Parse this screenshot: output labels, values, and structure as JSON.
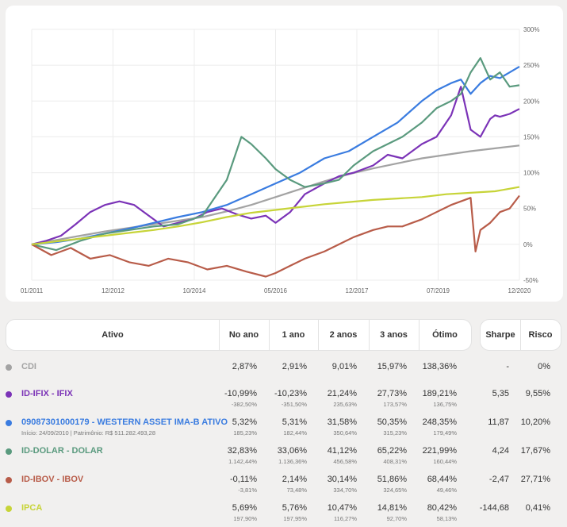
{
  "chart_data": {
    "type": "line",
    "x_labels": [
      "01/2011",
      "12/2012",
      "10/2014",
      "05/2016",
      "12/2017",
      "07/2019",
      "12/2020"
    ],
    "y_ticks": [
      "300%",
      "250%",
      "200%",
      "150%",
      "100%",
      "50%",
      "0%",
      "-50%"
    ],
    "ylim": [
      -50,
      300
    ],
    "grid": true,
    "series": [
      {
        "name": "CDI",
        "color": "#a3a3a3",
        "x": [
          0,
          0.05,
          0.1,
          0.15,
          0.2,
          0.25,
          0.3,
          0.35,
          0.4,
          0.45,
          0.5,
          0.55,
          0.6,
          0.65,
          0.7,
          0.75,
          0.8,
          0.85,
          0.9,
          0.95,
          1.0
        ],
        "y": [
          0,
          6,
          12,
          18,
          23,
          28,
          33,
          38,
          46,
          55,
          66,
          77,
          88,
          98,
          106,
          113,
          120,
          125,
          130,
          134,
          138
        ]
      },
      {
        "name": "ID-IFIX - IFIX",
        "color": "#7b33b7",
        "x": [
          0,
          0.03,
          0.06,
          0.09,
          0.12,
          0.15,
          0.18,
          0.21,
          0.24,
          0.27,
          0.3,
          0.33,
          0.36,
          0.39,
          0.42,
          0.45,
          0.48,
          0.5,
          0.53,
          0.56,
          0.6,
          0.63,
          0.66,
          0.7,
          0.73,
          0.76,
          0.8,
          0.83,
          0.86,
          0.88,
          0.9,
          0.92,
          0.94,
          0.95,
          0.96,
          0.98,
          1.0
        ],
        "y": [
          0,
          5,
          12,
          28,
          45,
          55,
          60,
          55,
          40,
          25,
          30,
          35,
          45,
          50,
          42,
          36,
          40,
          30,
          45,
          70,
          85,
          95,
          100,
          110,
          125,
          120,
          140,
          150,
          180,
          220,
          160,
          150,
          175,
          180,
          178,
          182,
          189
        ]
      },
      {
        "name": "09087301000179 - WESTERN ASSET IMA-B ATIVO",
        "color": "#3a7ce0",
        "x": [
          0,
          0.05,
          0.1,
          0.15,
          0.2,
          0.25,
          0.3,
          0.35,
          0.4,
          0.45,
          0.5,
          0.55,
          0.6,
          0.65,
          0.7,
          0.75,
          0.8,
          0.83,
          0.86,
          0.88,
          0.9,
          0.92,
          0.94,
          0.96,
          0.98,
          1.0
        ],
        "y": [
          0,
          3,
          8,
          15,
          22,
          30,
          38,
          45,
          55,
          70,
          85,
          100,
          120,
          130,
          150,
          170,
          200,
          215,
          225,
          230,
          210,
          225,
          235,
          232,
          240,
          248
        ]
      },
      {
        "name": "ID-DOLAR - DOLAR",
        "color": "#5a9a7e",
        "x": [
          0,
          0.05,
          0.1,
          0.15,
          0.2,
          0.25,
          0.3,
          0.35,
          0.4,
          0.43,
          0.45,
          0.48,
          0.5,
          0.53,
          0.56,
          0.6,
          0.63,
          0.66,
          0.7,
          0.73,
          0.76,
          0.8,
          0.83,
          0.86,
          0.88,
          0.9,
          0.92,
          0.94,
          0.96,
          0.98,
          1.0
        ],
        "y": [
          0,
          -8,
          5,
          15,
          20,
          25,
          28,
          40,
          90,
          150,
          140,
          120,
          105,
          90,
          80,
          85,
          90,
          110,
          130,
          140,
          150,
          170,
          190,
          200,
          210,
          240,
          260,
          230,
          240,
          220,
          222
        ]
      },
      {
        "name": "ID-IBOV - IBOV",
        "color": "#b85c49",
        "x": [
          0,
          0.04,
          0.08,
          0.12,
          0.16,
          0.2,
          0.24,
          0.28,
          0.32,
          0.36,
          0.4,
          0.44,
          0.48,
          0.5,
          0.53,
          0.56,
          0.6,
          0.63,
          0.66,
          0.7,
          0.73,
          0.76,
          0.8,
          0.83,
          0.86,
          0.88,
          0.9,
          0.91,
          0.92,
          0.94,
          0.96,
          0.98,
          1.0
        ],
        "y": [
          0,
          -15,
          -5,
          -20,
          -15,
          -25,
          -30,
          -20,
          -25,
          -35,
          -30,
          -38,
          -45,
          -40,
          -30,
          -20,
          -10,
          0,
          10,
          20,
          25,
          25,
          35,
          45,
          55,
          60,
          65,
          -10,
          20,
          30,
          45,
          50,
          68
        ]
      },
      {
        "name": "IPCA",
        "color": "#c7d438",
        "x": [
          0,
          0.05,
          0.1,
          0.15,
          0.2,
          0.25,
          0.3,
          0.35,
          0.4,
          0.45,
          0.5,
          0.55,
          0.6,
          0.65,
          0.7,
          0.75,
          0.8,
          0.85,
          0.9,
          0.95,
          1.0
        ],
        "y": [
          0,
          4,
          8,
          12,
          16,
          20,
          25,
          31,
          38,
          44,
          48,
          52,
          56,
          59,
          62,
          64,
          66,
          70,
          72,
          74,
          80
        ]
      }
    ]
  },
  "table": {
    "headers": {
      "ativo": "Ativo",
      "no_ano": "No ano",
      "um_ano": "1 ano",
      "dois_anos": "2 anos",
      "tres_anos": "3 anos",
      "otimo": "Ótimo",
      "sharpe": "Sharpe",
      "risco": "Risco"
    },
    "rows": [
      {
        "name": "CDI",
        "color": "#a3a3a3",
        "sub": "",
        "no_ano": "2,87%",
        "no_ano_sub": "",
        "um_ano": "2,91%",
        "um_ano_sub": "",
        "dois_anos": "9,01%",
        "dois_anos_sub": "",
        "tres_anos": "15,97%",
        "tres_anos_sub": "",
        "otimo": "138,36%",
        "otimo_sub": "",
        "sharpe": "-",
        "risco": "0%"
      },
      {
        "name": "ID-IFIX - IFIX",
        "color": "#7b33b7",
        "sub": "",
        "no_ano": "-10,99%",
        "no_ano_sub": "-382,50%",
        "um_ano": "-10,23%",
        "um_ano_sub": "-351,50%",
        "dois_anos": "21,24%",
        "dois_anos_sub": "235,63%",
        "tres_anos": "27,73%",
        "tres_anos_sub": "173,57%",
        "otimo": "189,21%",
        "otimo_sub": "136,75%",
        "sharpe": "5,35",
        "risco": "9,55%"
      },
      {
        "name": "09087301000179 - WESTERN ASSET IMA-B ATIVO",
        "color": "#3a7ce0",
        "sub": "Início: 24/09/2010 | Patrimônio: R$ 511.282.493,28",
        "no_ano": "5,32%",
        "no_ano_sub": "185,23%",
        "um_ano": "5,31%",
        "um_ano_sub": "182,44%",
        "dois_anos": "31,58%",
        "dois_anos_sub": "350,64%",
        "tres_anos": "50,35%",
        "tres_anos_sub": "315,23%",
        "otimo": "248,35%",
        "otimo_sub": "179,49%",
        "sharpe": "11,87",
        "risco": "10,20%"
      },
      {
        "name": "ID-DOLAR - DOLAR",
        "color": "#5a9a7e",
        "sub": "",
        "no_ano": "32,83%",
        "no_ano_sub": "1.142,44%",
        "um_ano": "33,06%",
        "um_ano_sub": "1.136,36%",
        "dois_anos": "41,12%",
        "dois_anos_sub": "456,58%",
        "tres_anos": "65,22%",
        "tres_anos_sub": "408,31%",
        "otimo": "221,99%",
        "otimo_sub": "160,44%",
        "sharpe": "4,24",
        "risco": "17,67%"
      },
      {
        "name": "ID-IBOV - IBOV",
        "color": "#b85c49",
        "sub": "",
        "no_ano": "-0,11%",
        "no_ano_sub": "-3,81%",
        "um_ano": "2,14%",
        "um_ano_sub": "73,48%",
        "dois_anos": "30,14%",
        "dois_anos_sub": "334,70%",
        "tres_anos": "51,86%",
        "tres_anos_sub": "324,65%",
        "otimo": "68,44%",
        "otimo_sub": "49,46%",
        "sharpe": "-2,47",
        "risco": "27,71%"
      },
      {
        "name": "IPCA",
        "color": "#c7d438",
        "sub": "",
        "no_ano": "5,69%",
        "no_ano_sub": "197,90%",
        "um_ano": "5,76%",
        "um_ano_sub": "197,95%",
        "dois_anos": "10,47%",
        "dois_anos_sub": "116,27%",
        "tres_anos": "14,81%",
        "tres_anos_sub": "92,70%",
        "otimo": "80,42%",
        "otimo_sub": "58,13%",
        "sharpe": "-144,68",
        "risco": "0,41%"
      }
    ]
  }
}
